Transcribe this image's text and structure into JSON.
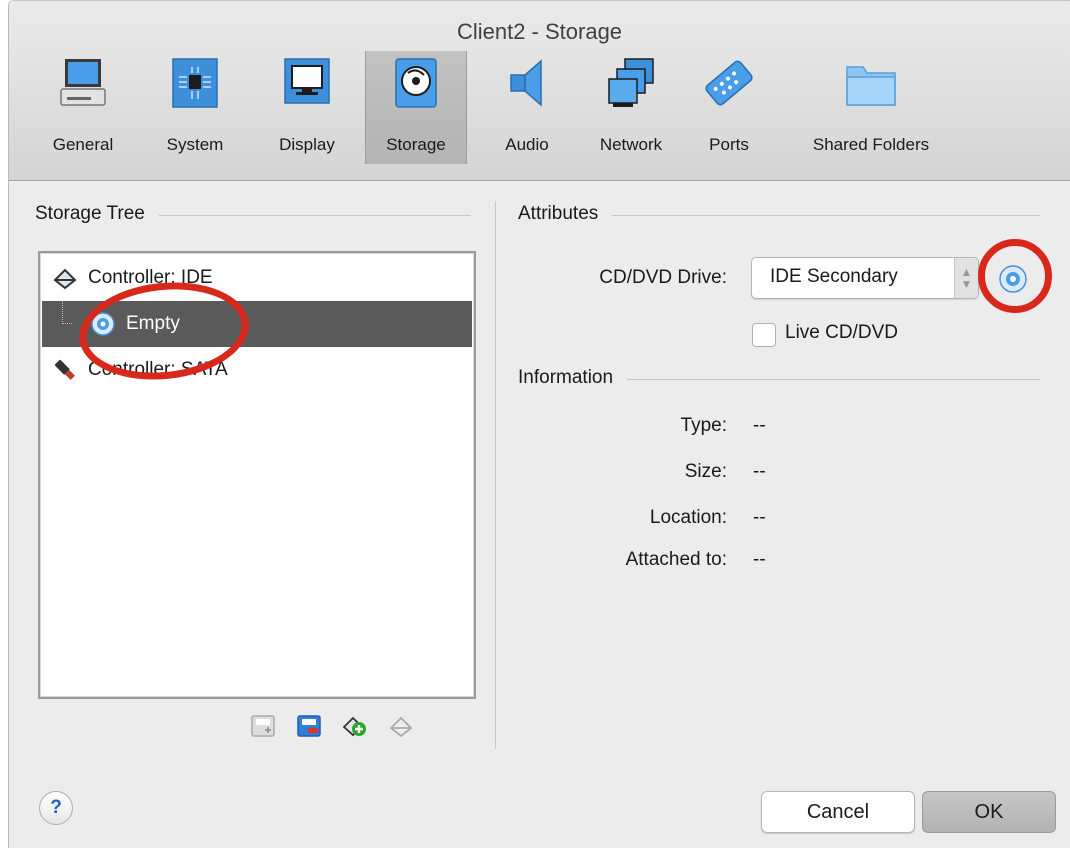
{
  "window": {
    "title": "Client2 - Storage"
  },
  "toolbar": {
    "items": [
      {
        "label": "General",
        "icon": "monitor-icon"
      },
      {
        "label": "System",
        "icon": "chip-icon"
      },
      {
        "label": "Display",
        "icon": "display-icon"
      },
      {
        "label": "Storage",
        "icon": "disk-icon",
        "selected": true
      },
      {
        "label": "Audio",
        "icon": "speaker-icon"
      },
      {
        "label": "Network",
        "icon": "network-icon"
      },
      {
        "label": "Ports",
        "icon": "serial-port-icon"
      },
      {
        "label": "Shared Folders",
        "icon": "folder-icon"
      }
    ]
  },
  "storage_tree": {
    "title": "Storage Tree",
    "rows": [
      {
        "label": "Controller: IDE",
        "icon": "ide-controller-icon"
      },
      {
        "label": "Empty",
        "icon": "cd-dvd-icon",
        "selected": true
      },
      {
        "label": "Controller: SATA",
        "icon": "sata-controller-icon"
      }
    ]
  },
  "attributes": {
    "title": "Attributes",
    "cd_dvd_drive_label": "CD/DVD Drive:",
    "cd_dvd_drive_value": "IDE Secondary",
    "live_cd_label": "Live CD/DVD",
    "live_cd_checked": false
  },
  "information": {
    "title": "Information",
    "type_label": "Type:",
    "type_value": "--",
    "size_label": "Size:",
    "size_value": "--",
    "location_label": "Location:",
    "location_value": "--",
    "attached_label": "Attached to:",
    "attached_value": "--"
  },
  "buttons": {
    "help": "?",
    "cancel": "Cancel",
    "ok": "OK"
  },
  "colors": {
    "annotation": "#d8281c",
    "selection": "#5a5a5a"
  }
}
